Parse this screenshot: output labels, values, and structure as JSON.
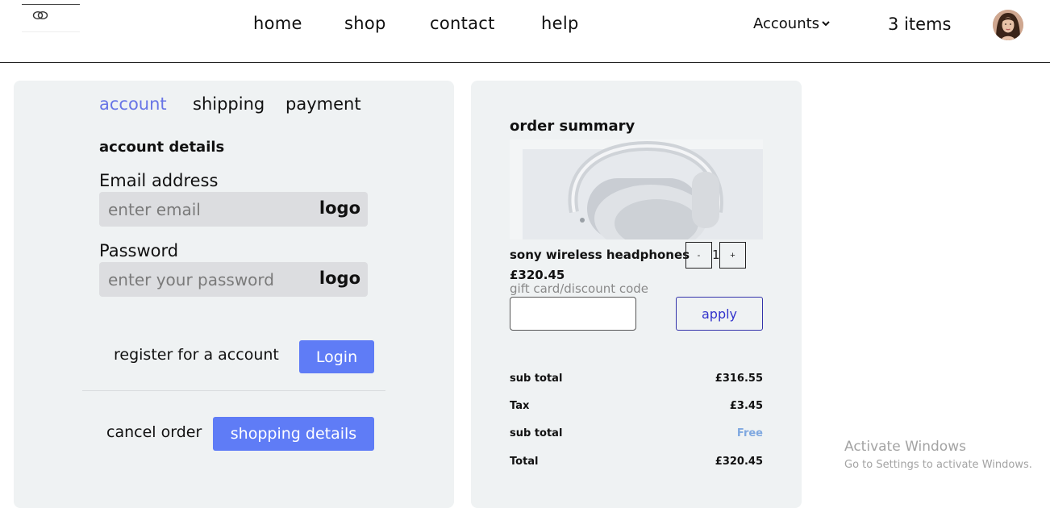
{
  "header": {
    "nav": [
      {
        "label": "home"
      },
      {
        "label": "shop"
      },
      {
        "label": "contact"
      },
      {
        "label": "help"
      }
    ],
    "accounts_label": "Accounts",
    "cart_label": "3 items"
  },
  "checkout": {
    "tabs": [
      {
        "label": "account",
        "active": true
      },
      {
        "label": "shipping",
        "active": false
      },
      {
        "label": "payment",
        "active": false
      }
    ],
    "section_title": "account details",
    "email": {
      "label": "Email address",
      "placeholder": "enter email",
      "logo_text": "logo"
    },
    "password": {
      "label": "Password",
      "placeholder": "enter your password",
      "logo_text": "logo"
    },
    "register_text": "register for a account",
    "login_label": "Login",
    "cancel_text": "cancel order",
    "shopping_details_label": "shopping details"
  },
  "order": {
    "title": "order summary",
    "product_name": "sony wireless headphones",
    "qty_minus": "-",
    "qty_plus": "+",
    "quantity": "1",
    "price": "£320.45",
    "gift_label": "gift card/discount code",
    "apply_label": "apply",
    "summary": [
      {
        "label": "sub total",
        "value": "£316.55"
      },
      {
        "label": "Tax",
        "value": "£3.45"
      },
      {
        "label": "sub total",
        "value": "Free"
      },
      {
        "label": "Total",
        "value": "£320.45"
      }
    ]
  },
  "watermark": {
    "title": "Activate Windows",
    "subtitle": "Go to Settings to activate Windows."
  },
  "colors": {
    "accent": "#5f7cf6",
    "active_tab": "#6774e6",
    "panel_bg": "#eff2f3",
    "free": "#7fa8e0"
  }
}
